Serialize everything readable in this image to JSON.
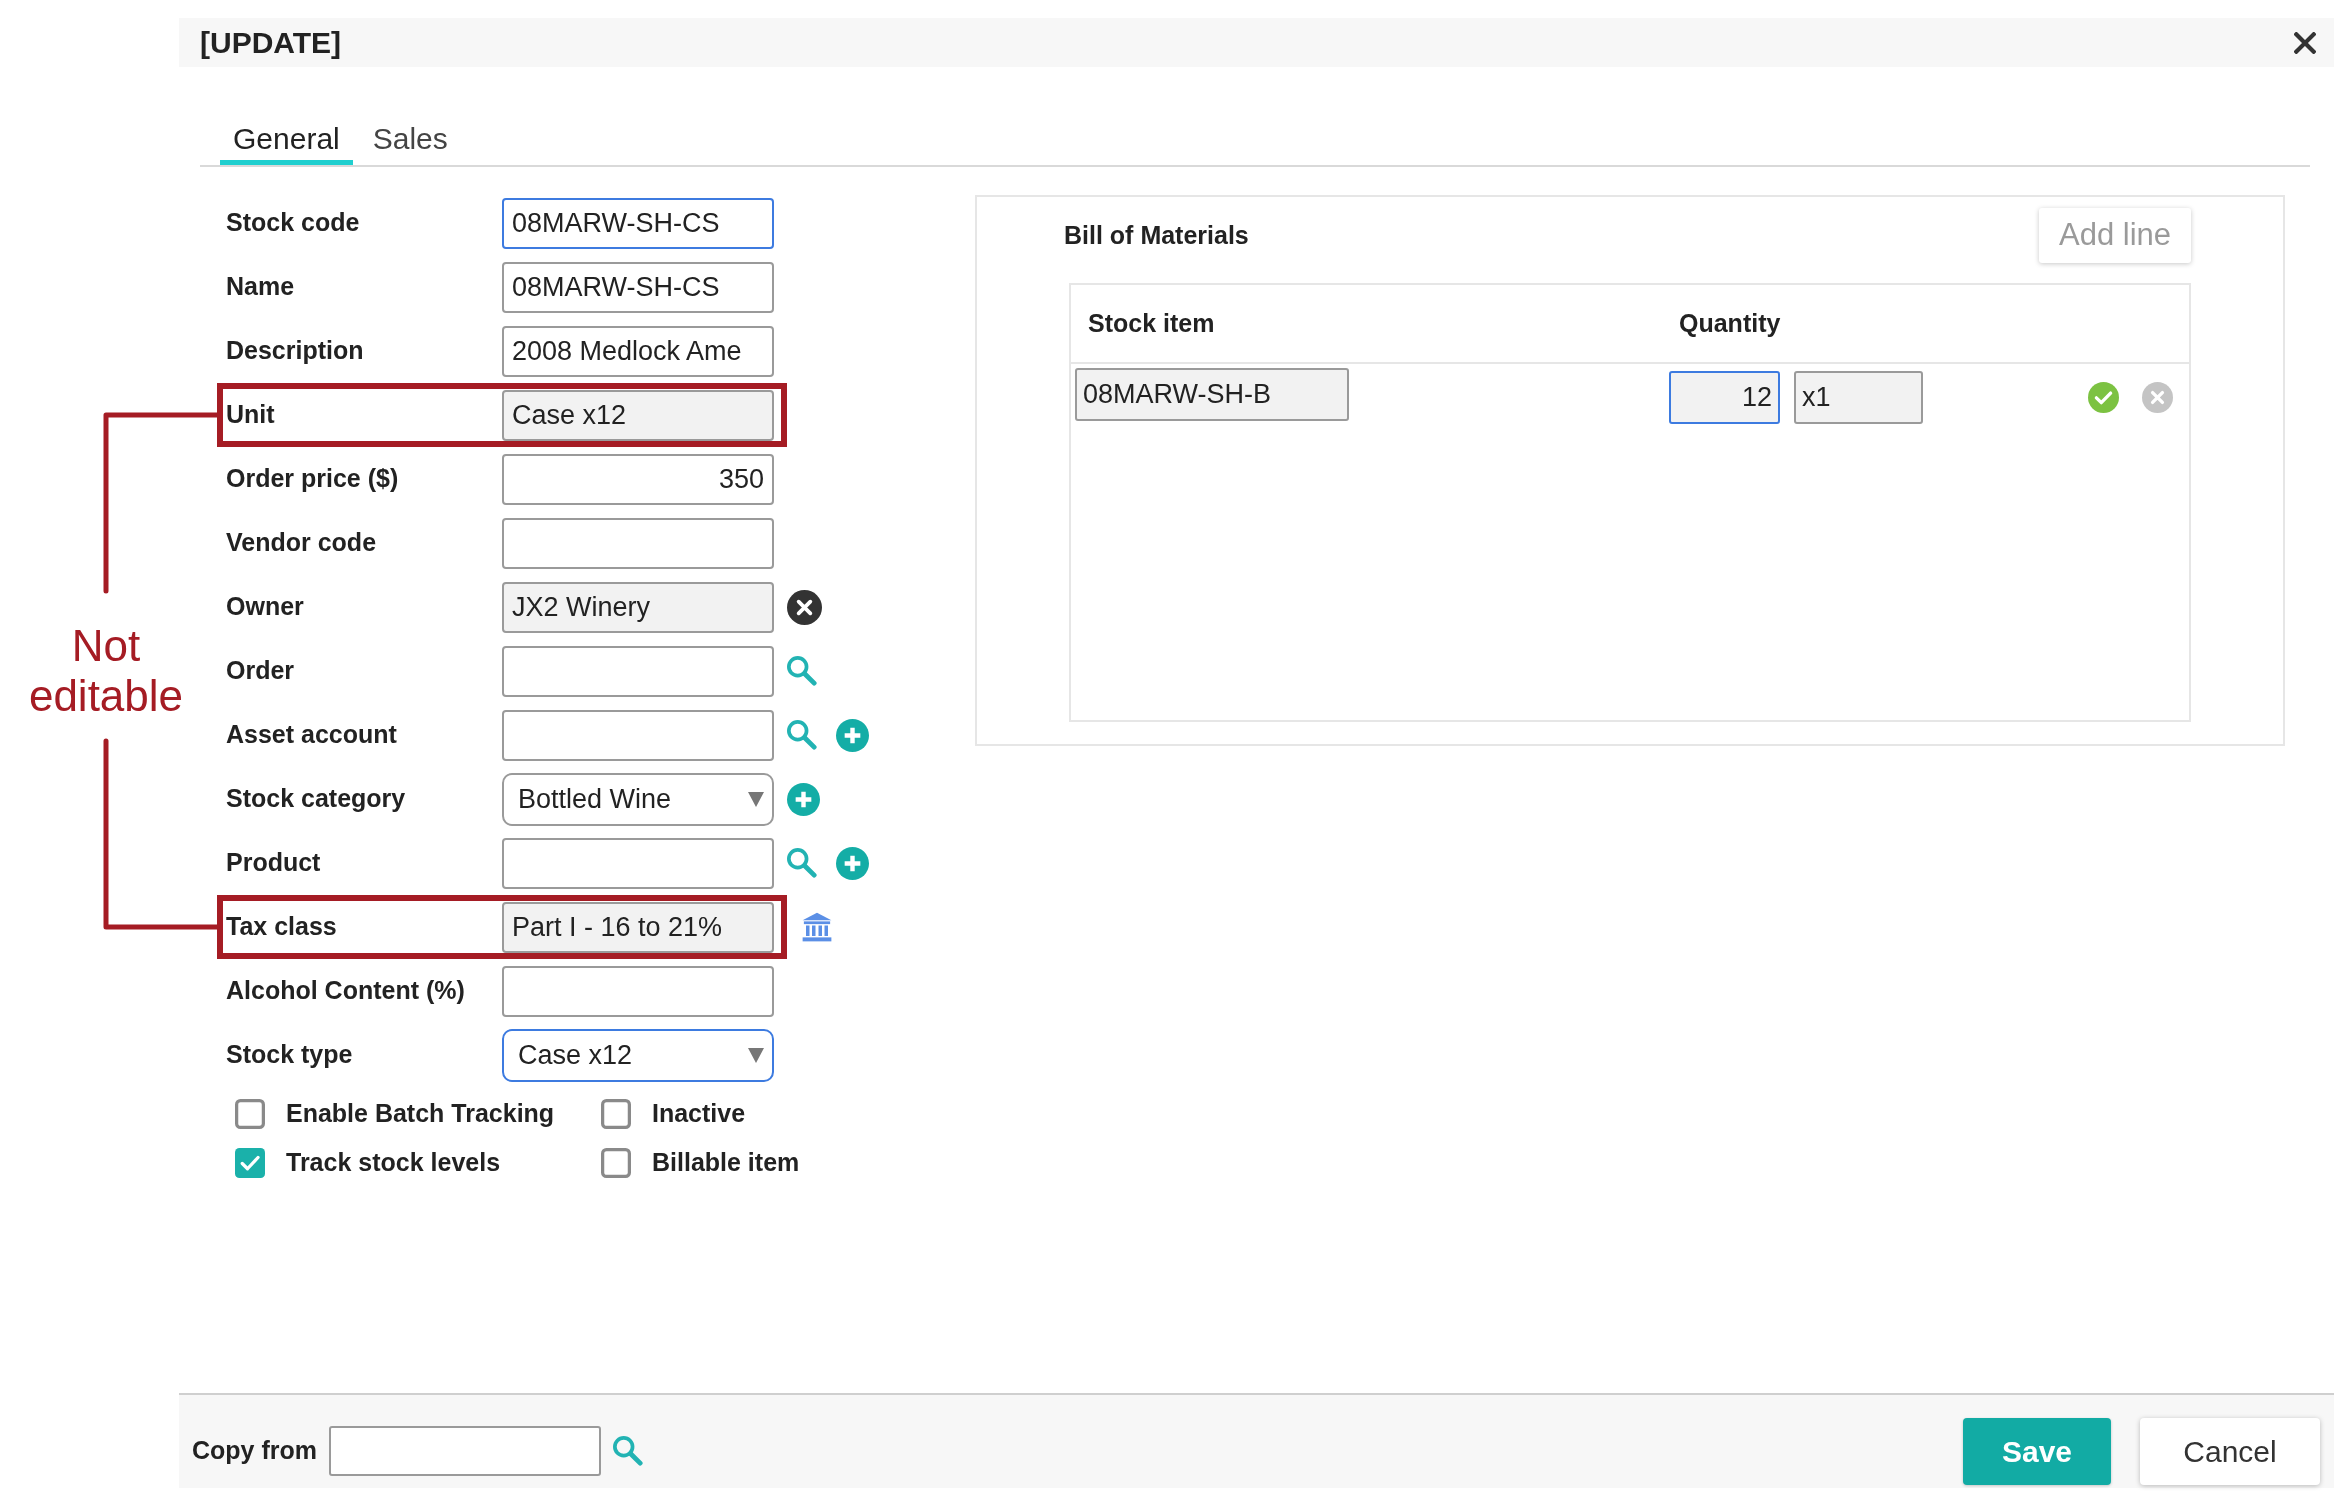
{
  "dialog": {
    "title": "[UPDATE]"
  },
  "tabs": [
    {
      "label": "General",
      "selected": true
    },
    {
      "label": "Sales",
      "selected": false
    }
  ],
  "fields": [
    {
      "label": "Stock code",
      "kind": "text",
      "value": "08MARW-SH-CS",
      "focused": true,
      "readonly": false,
      "highlighted": false
    },
    {
      "label": "Name",
      "kind": "text",
      "value": "08MARW-SH-CS",
      "focused": false,
      "readonly": false,
      "highlighted": false
    },
    {
      "label": "Description",
      "kind": "text",
      "value": "2008 Medlock Ame",
      "focused": false,
      "readonly": false,
      "highlighted": false
    },
    {
      "label": "Unit",
      "kind": "text",
      "value": "Case x12",
      "focused": false,
      "readonly": true,
      "highlighted": true
    },
    {
      "label": "Order price ($)",
      "kind": "number",
      "value": "350",
      "focused": false,
      "readonly": false,
      "highlighted": false
    },
    {
      "label": "Vendor code",
      "kind": "text",
      "focused": false,
      "readonly": false,
      "highlighted": false
    },
    {
      "label": "Owner",
      "kind": "text",
      "value": "JX2 Winery",
      "focused": false,
      "readonly": true,
      "highlighted": false,
      "actions": [
        {
          "kind": "clear"
        }
      ]
    },
    {
      "label": "Order",
      "kind": "text",
      "focused": false,
      "readonly": false,
      "highlighted": false,
      "actions": [
        {
          "kind": "search"
        }
      ]
    },
    {
      "label": "Asset account",
      "kind": "text",
      "focused": false,
      "readonly": false,
      "highlighted": false,
      "actions": [
        {
          "kind": "search"
        },
        {
          "kind": "add"
        }
      ]
    },
    {
      "label": "Stock category",
      "kind": "select",
      "value": "Bottled Wine",
      "focused": false,
      "readonly": false,
      "highlighted": false,
      "actions": [
        {
          "kind": "add"
        }
      ]
    },
    {
      "label": "Product",
      "kind": "text",
      "focused": false,
      "readonly": false,
      "highlighted": false,
      "actions": [
        {
          "kind": "search"
        },
        {
          "kind": "add"
        }
      ]
    },
    {
      "label": "Tax class",
      "kind": "text",
      "value": "Part I - 16 to 21%",
      "focused": false,
      "readonly": true,
      "highlighted": true,
      "actions": [
        {
          "kind": "bank"
        }
      ]
    },
    {
      "label": "Alcohol Content (%)",
      "kind": "text",
      "focused": false,
      "readonly": false,
      "highlighted": false
    },
    {
      "label": "Stock type",
      "kind": "select",
      "value": "Case x12",
      "focused": true,
      "readonly": false,
      "highlighted": false
    }
  ],
  "checkboxes": [
    {
      "label": "Enable Batch Tracking",
      "checked": false
    },
    {
      "label": "Inactive",
      "checked": false
    },
    {
      "label": "Track stock levels",
      "checked": true
    },
    {
      "label": "Billable item",
      "checked": false
    }
  ],
  "annotation": {
    "text": "Not editable"
  },
  "bill_of_materials": {
    "title": "Bill of Materials",
    "add_button": "Add line",
    "columns": [
      "Stock item",
      "Quantity"
    ],
    "rows": [
      {
        "stock_item": "08MARW-SH-B",
        "quantity": "12",
        "quantity_focused": true,
        "unit": "x1"
      }
    ]
  },
  "footer": {
    "copy_from_label": "Copy from",
    "buttons": [
      {
        "label": "Save",
        "kind": "primary"
      },
      {
        "label": "Cancel",
        "kind": "secondary"
      }
    ]
  }
}
